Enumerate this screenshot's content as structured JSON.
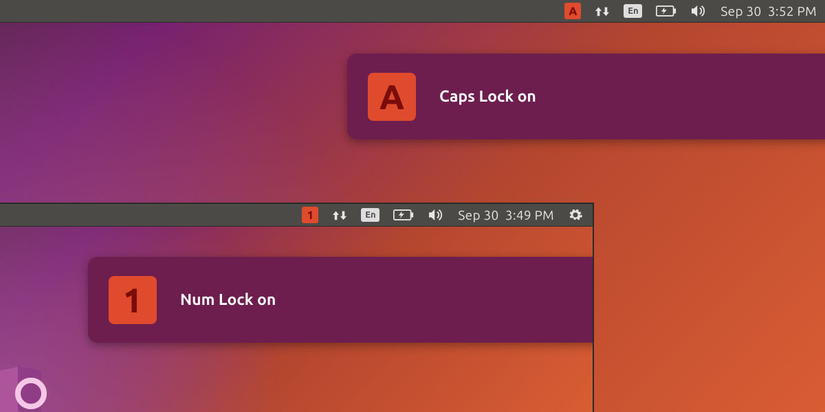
{
  "outer": {
    "topbar": {
      "lock_indicator": "A",
      "language": "En",
      "clock": "Sep 30  3:52 PM"
    },
    "notification": {
      "badge": "A",
      "message": "Caps Lock on"
    }
  },
  "inner": {
    "topbar": {
      "lock_indicator": "1",
      "language": "En",
      "clock": "Sep 30  3:49 PM"
    },
    "notification": {
      "badge": "1",
      "message": "Num Lock on"
    }
  }
}
